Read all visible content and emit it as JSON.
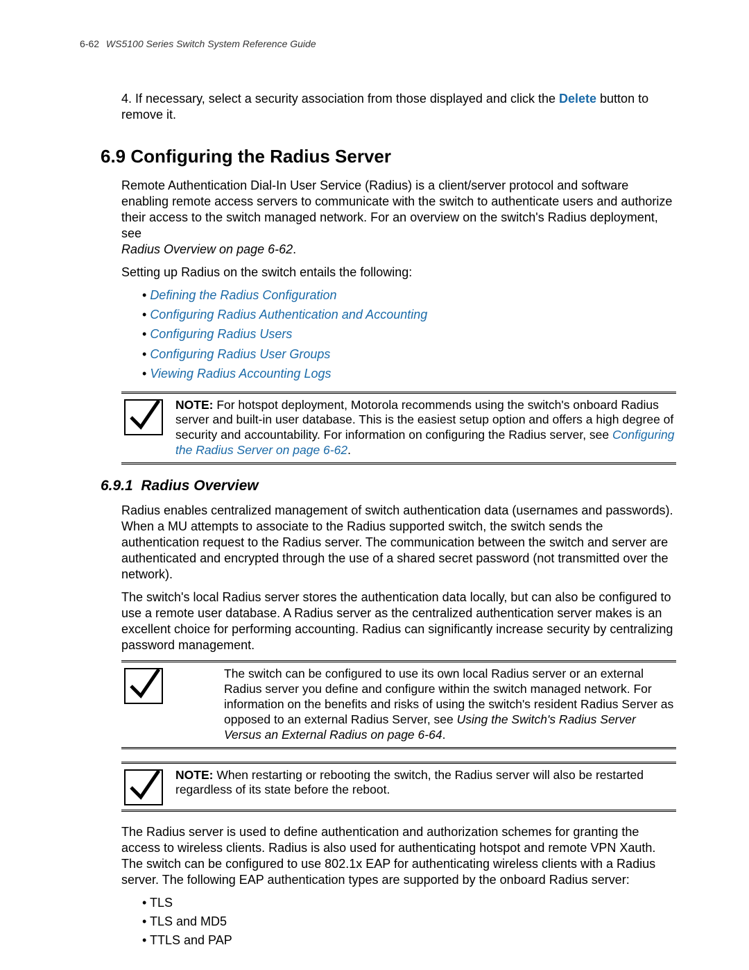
{
  "header": {
    "page_number": "6-62",
    "title": "WS5100 Series Switch System Reference Guide"
  },
  "ol_step": {
    "num": "4.",
    "prefix": "If necessary, select a security association from those displayed and click the ",
    "delete": "Delete",
    "suffix": " button to remove it."
  },
  "section": {
    "number": "6.9",
    "title": "Configuring the Radius Server"
  },
  "intro": {
    "p1": "Remote Authentication Dial-In User Service (Radius) is a client/server protocol and software enabling remote access servers to communicate with the switch to authenticate users and authorize their access to the switch managed network. For an overview on the switch's Radius deployment, see",
    "p1ref": "Radius Overview on page 6-62",
    "p2": "Setting up Radius on the switch entails the following:"
  },
  "toc": [
    "Defining the Radius Configuration",
    "Configuring Radius Authentication and Accounting",
    "Configuring Radius Users",
    "Configuring Radius User Groups",
    "Viewing Radius Accounting Logs"
  ],
  "note1": {
    "label": "NOTE:",
    "body": " For hotspot deployment, Motorola recommends using the switch's onboard Radius server and built-in user database. This is the easiest setup option and offers a high degree of security and accountability. For information on configuring the Radius server, see ",
    "link": "Configuring the Radius Server on page 6-62",
    "tail": "."
  },
  "subsection": {
    "number": "6.9.1",
    "title": "Radius Overview"
  },
  "overview": {
    "p1": "Radius enables centralized management of switch authentication data (usernames and passwords). When a MU attempts to associate to the Radius supported switch, the switch sends the authentication request to the Radius server. The communication between the switch and server are authenticated and encrypted through the use of a shared secret password (not transmitted over the network).",
    "p2": "The switch's local Radius server stores the authentication data locally, but can also be configured to use a remote user database. A Radius server as the centralized authentication server makes is an excellent choice for performing accounting. Radius can significantly increase security by centralizing password management."
  },
  "note2": {
    "body1": "The switch can be configured to use its own local Radius server or an external Radius server you define and configure within the switch managed network. For information on the benefits and risks of using the switch's resident Radius Server as opposed to an external Radius Server, see ",
    "ref": "Using the Switch's Radius Server Versus an External Radius on page 6-64",
    "tail": "."
  },
  "note3": {
    "label": "NOTE:",
    "body": " When restarting or rebooting the switch, the Radius server will also be restarted regardless of its state before the reboot."
  },
  "after": {
    "p1": "The Radius server is used to define authentication and authorization schemes for granting the access to wireless clients. Radius is also used for authenticating hotspot and remote VPN Xauth. The switch can be configured to use 802.1x EAP for authenticating wireless clients with a Radius server. The following EAP authentication types are supported by the onboard Radius server:"
  },
  "eap_list": [
    "TLS",
    "TLS and MD5",
    "TTLS and PAP"
  ]
}
